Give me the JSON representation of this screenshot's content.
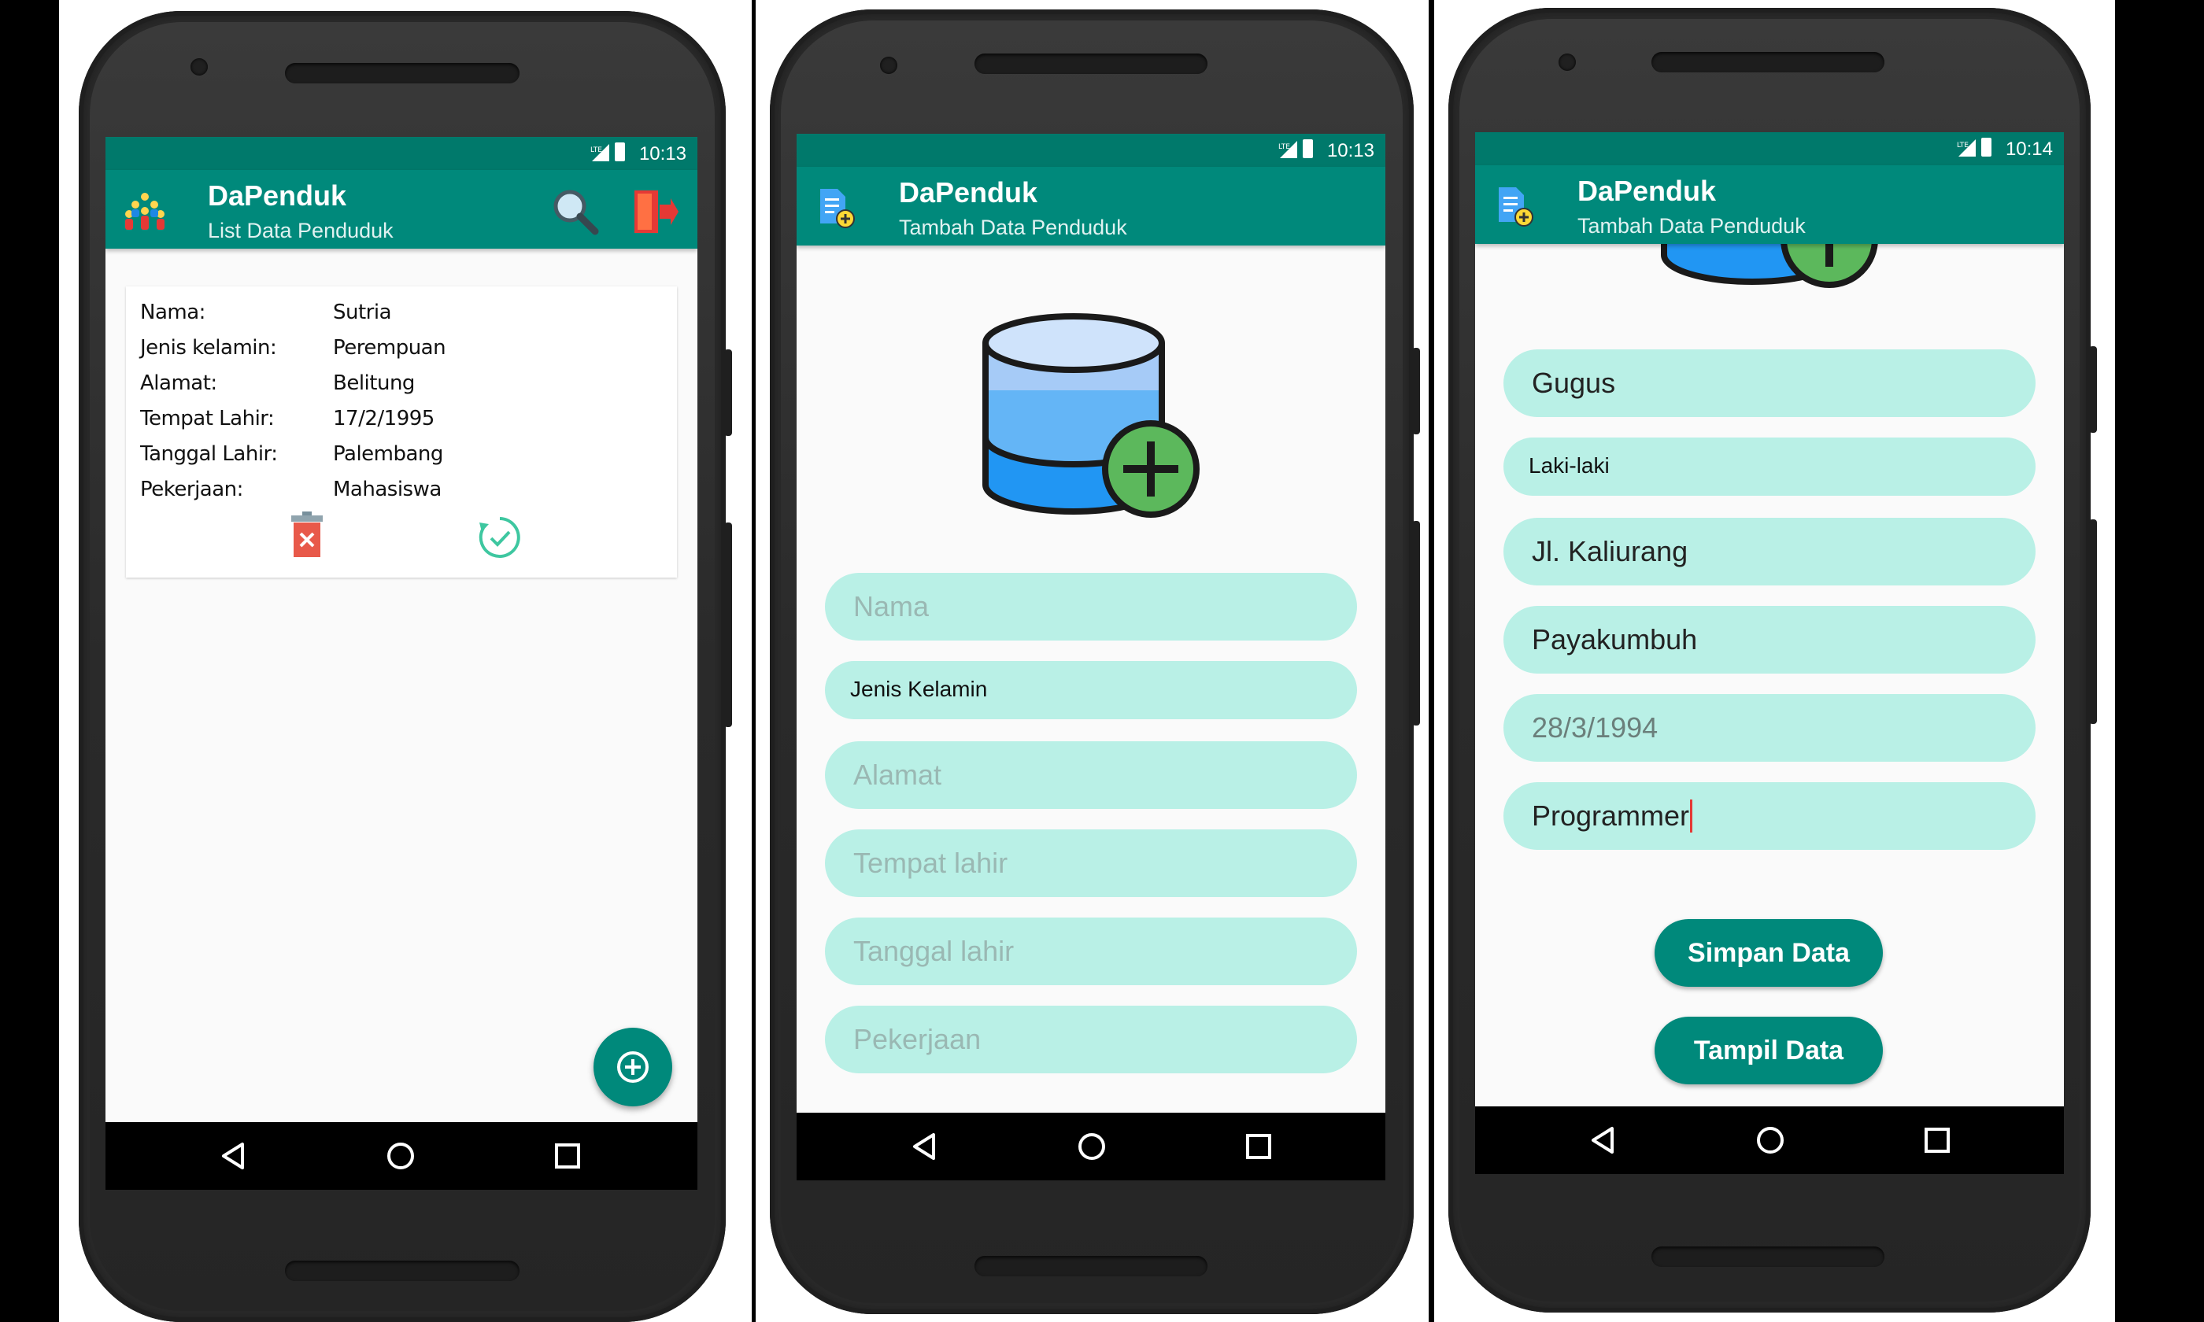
{
  "app_name": "DaPenduk",
  "phones": [
    {
      "status_time": "10:13",
      "subtitle": "List Data Penduduk",
      "card": {
        "rows": [
          {
            "label": "Nama:",
            "value": "Sutria"
          },
          {
            "label": "Jenis kelamin:",
            "value": "Perempuan"
          },
          {
            "label": "Alamat:",
            "value": "Belitung"
          },
          {
            "label": "Tempat Lahir:",
            "value": "17/2/1995"
          },
          {
            "label": "Tanggal Lahir:",
            "value": "Palembang"
          },
          {
            "label": "Pekerjaan:",
            "value": "Mahasiswa"
          }
        ]
      },
      "icons": [
        "people-icon",
        "search-icon",
        "logout-icon",
        "delete-icon",
        "update-icon",
        "add-fab-icon"
      ]
    },
    {
      "status_time": "10:13",
      "subtitle": "Tambah Data Penduduk",
      "fields": [
        {
          "placeholder": "Nama",
          "value": ""
        },
        {
          "placeholder": "Jenis Kelamin",
          "value": "Jenis Kelamin"
        },
        {
          "placeholder": "Alamat",
          "value": ""
        },
        {
          "placeholder": "Tempat lahir",
          "value": ""
        },
        {
          "placeholder": "Tanggal lahir",
          "value": ""
        },
        {
          "placeholder": "Pekerjaan",
          "value": ""
        }
      ],
      "icons": [
        "add-document-icon",
        "database-add-icon"
      ]
    },
    {
      "status_time": "10:14",
      "subtitle": "Tambah Data Penduduk",
      "fields": [
        {
          "value": "Gugus"
        },
        {
          "value": "Laki-laki"
        },
        {
          "value": "Jl. Kaliurang"
        },
        {
          "value": "Payakumbuh"
        },
        {
          "value": "28/3/1994"
        },
        {
          "value": "Programmer"
        }
      ],
      "buttons": {
        "save": "Simpan Data",
        "show": "Tampil Data"
      }
    }
  ],
  "colors": {
    "primary": "#00897b",
    "primary_dark": "#00796b",
    "field_bg": "#b9f0e6",
    "delete_red": "#e8594a",
    "check_green": "#3ec7a0"
  }
}
